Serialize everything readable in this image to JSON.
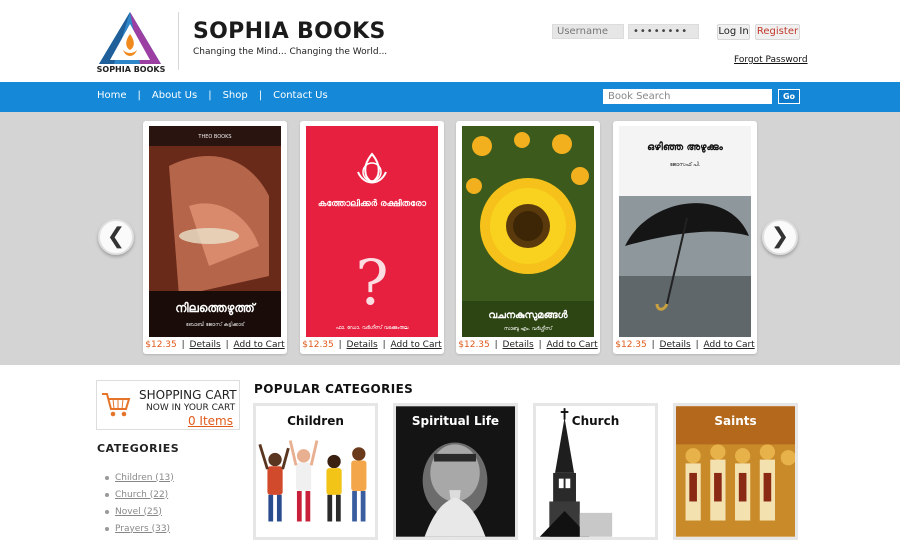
{
  "header": {
    "logo_text": "SOPHIA BOOKS",
    "brand_name": "SOPHIA BOOKS",
    "tagline": "Changing the Mind... Changing the World...",
    "username_placeholder": "Username",
    "password_value": "••••••••",
    "login_label": "Log In",
    "register_label": "Register",
    "forgot_label": "Forgot Password"
  },
  "nav": {
    "items": [
      "Home",
      "About Us",
      "Shop",
      "Contact Us"
    ],
    "separator": "|",
    "search_placeholder": "Book Search",
    "go_label": "Go"
  },
  "carousel": {
    "prev_icon": "chevron-left-icon",
    "next_icon": "chevron-right-icon",
    "prev_glyph": "❮",
    "next_glyph": "❯",
    "books": [
      {
        "cover_title": "നിലത്തെഴുത്ത്",
        "cover_author": "ബോബി ജോസ് കട്ടിക്കാട്",
        "publisher": "THEO BOOKS",
        "price": "$12.35",
        "details_label": "Details",
        "cart_label": "Add to Cart"
      },
      {
        "cover_title": "കത്തോലിക്കർ രക്ഷിതരോ",
        "cover_author": "ഫാ. ഡോ. വർഗീസ് വടക്കുംതല",
        "price": "$12.35",
        "details_label": "Details",
        "cart_label": "Add to Cart"
      },
      {
        "cover_title": "വചനകുസുമങ്ങൾ",
        "cover_author": "സാബു എം. വർഗ്ഗീസ്",
        "price": "$12.35",
        "details_label": "Details",
        "cart_label": "Add to Cart"
      },
      {
        "cover_title": "ഒഴിഞ്ഞ അഴുക്കും",
        "cover_author": "ജോസഫ് പി.",
        "price": "$12.35",
        "details_label": "Details",
        "cart_label": "Add to Cart"
      }
    ]
  },
  "cart": {
    "title": "SHOPPING CART",
    "subtitle": "NOW IN YOUR CART",
    "count": "0 Items"
  },
  "categories": {
    "heading": "CATEGORIES",
    "items": [
      "Children (13)",
      "Church (22)",
      "Novel (25)",
      "Prayers (33)"
    ]
  },
  "popular": {
    "heading": "POPULAR CATEGORIES",
    "items": [
      {
        "label": "Children",
        "color": "#111111"
      },
      {
        "label": "Spiritual Life",
        "color": "#ffffff"
      },
      {
        "label": "Church",
        "color": "#111111"
      },
      {
        "label": "Saints",
        "color": "#ffffff"
      }
    ]
  },
  "colors": {
    "nav_blue": "#1589d8",
    "price_orange": "#e05a1a",
    "carousel_bg": "#d4d4d4"
  }
}
